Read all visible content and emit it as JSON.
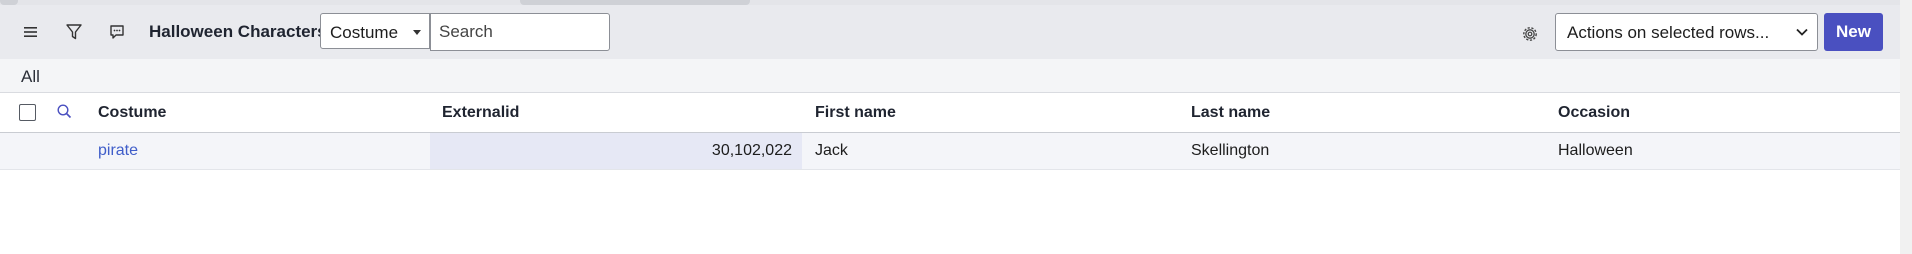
{
  "header": {
    "title": "Halloween Characters",
    "filter_field": "Costume",
    "search_placeholder": "Search",
    "actions_label": "Actions on selected rows...",
    "new_label": "New"
  },
  "breadcrumb": {
    "all_label": "All"
  },
  "table": {
    "columns": [
      "Costume",
      "Externalid",
      "First name",
      "Last name",
      "Occasion"
    ],
    "rows": [
      {
        "costume": "pirate",
        "externalid": "30,102,022",
        "first_name": "Jack",
        "last_name": "Skellington",
        "occasion": "Halloween"
      }
    ]
  },
  "icons": {
    "menu": "hamburger-menu-icon",
    "filter": "filter-funnel-icon",
    "comments": "chat-bubble-icon",
    "gear": "gear-icon",
    "column_search": "magnifier-icon"
  },
  "colors": {
    "primary": "#4a50c0",
    "link": "#3f5dc9",
    "header_bg": "#e9eaee"
  }
}
